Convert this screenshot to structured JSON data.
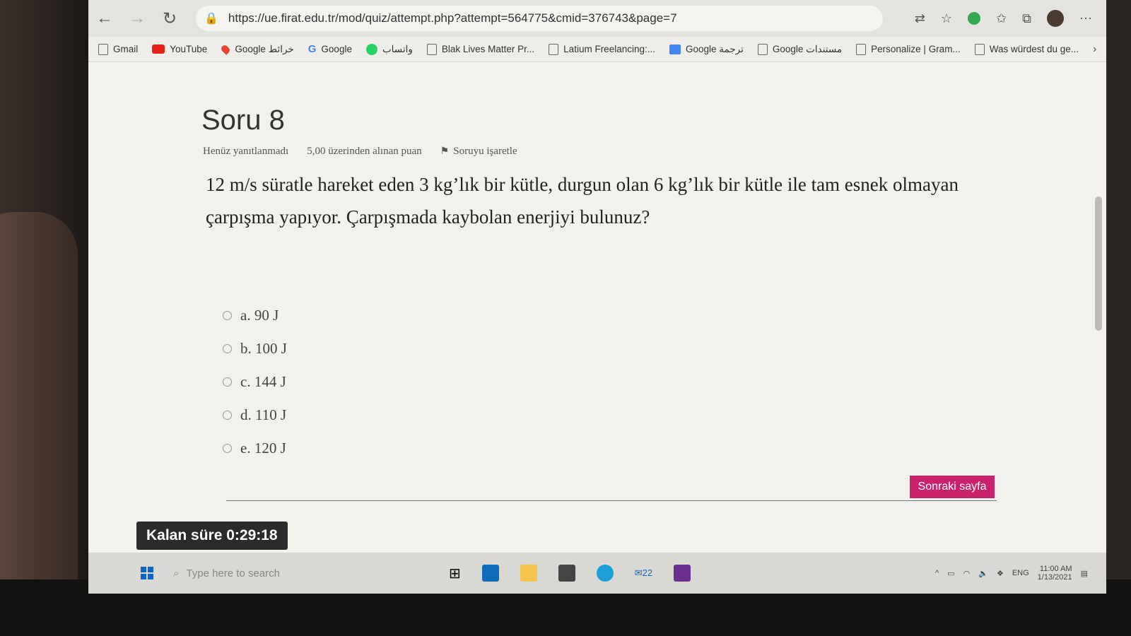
{
  "browser": {
    "url": "https://ue.firat.edu.tr/mod/quiz/attempt.php?attempt=564775&cmid=376743&page=7",
    "bookmarks": [
      {
        "label": "Gmail",
        "icon": "page-icon"
      },
      {
        "label": "YouTube",
        "icon": "youtube-icon"
      },
      {
        "label": "Google خرائط",
        "icon": "maps-icon"
      },
      {
        "label": "Google",
        "icon": "google-icon"
      },
      {
        "label": "واتساب",
        "icon": "whatsapp-icon"
      },
      {
        "label": "Blak Lives Matter Pr...",
        "icon": "page-icon"
      },
      {
        "label": "Latium Freelancing:...",
        "icon": "page-icon"
      },
      {
        "label": "Google ترجمة",
        "icon": "translate-icon"
      },
      {
        "label": "Google مستندات",
        "icon": "page-icon"
      },
      {
        "label": "Personalize | Gram...",
        "icon": "page-icon"
      },
      {
        "label": "Was würdest du ge...",
        "icon": "page-icon"
      }
    ]
  },
  "quiz": {
    "question_number": "Soru 8",
    "status": "Henüz yanıtlanmadı",
    "points": "5,00 üzerinden alınan puan",
    "flag_label": "Soruyu işaretle",
    "question_text": "12 m/s süratle hareket eden 3 kg’lık bir kütle, durgun olan 6 kg’lık bir kütle ile tam esnek olmayan çarpışma yapıyor. Çarpışmada kaybolan enerjiyi bulunuz?",
    "answers": [
      "a. 90 J",
      "b. 100 J",
      "c. 144 J",
      "d. 110 J",
      "e. 120 J"
    ],
    "next_button": "Sonraki sayfa",
    "timer": "Kalan süre 0:29:18",
    "accent_color": "#c8226b"
  },
  "taskbar": {
    "search_placeholder": "Type here to search",
    "mail_badge": "22",
    "language": "ENG",
    "time": "11:00 AM",
    "date": "1/13/2021"
  }
}
